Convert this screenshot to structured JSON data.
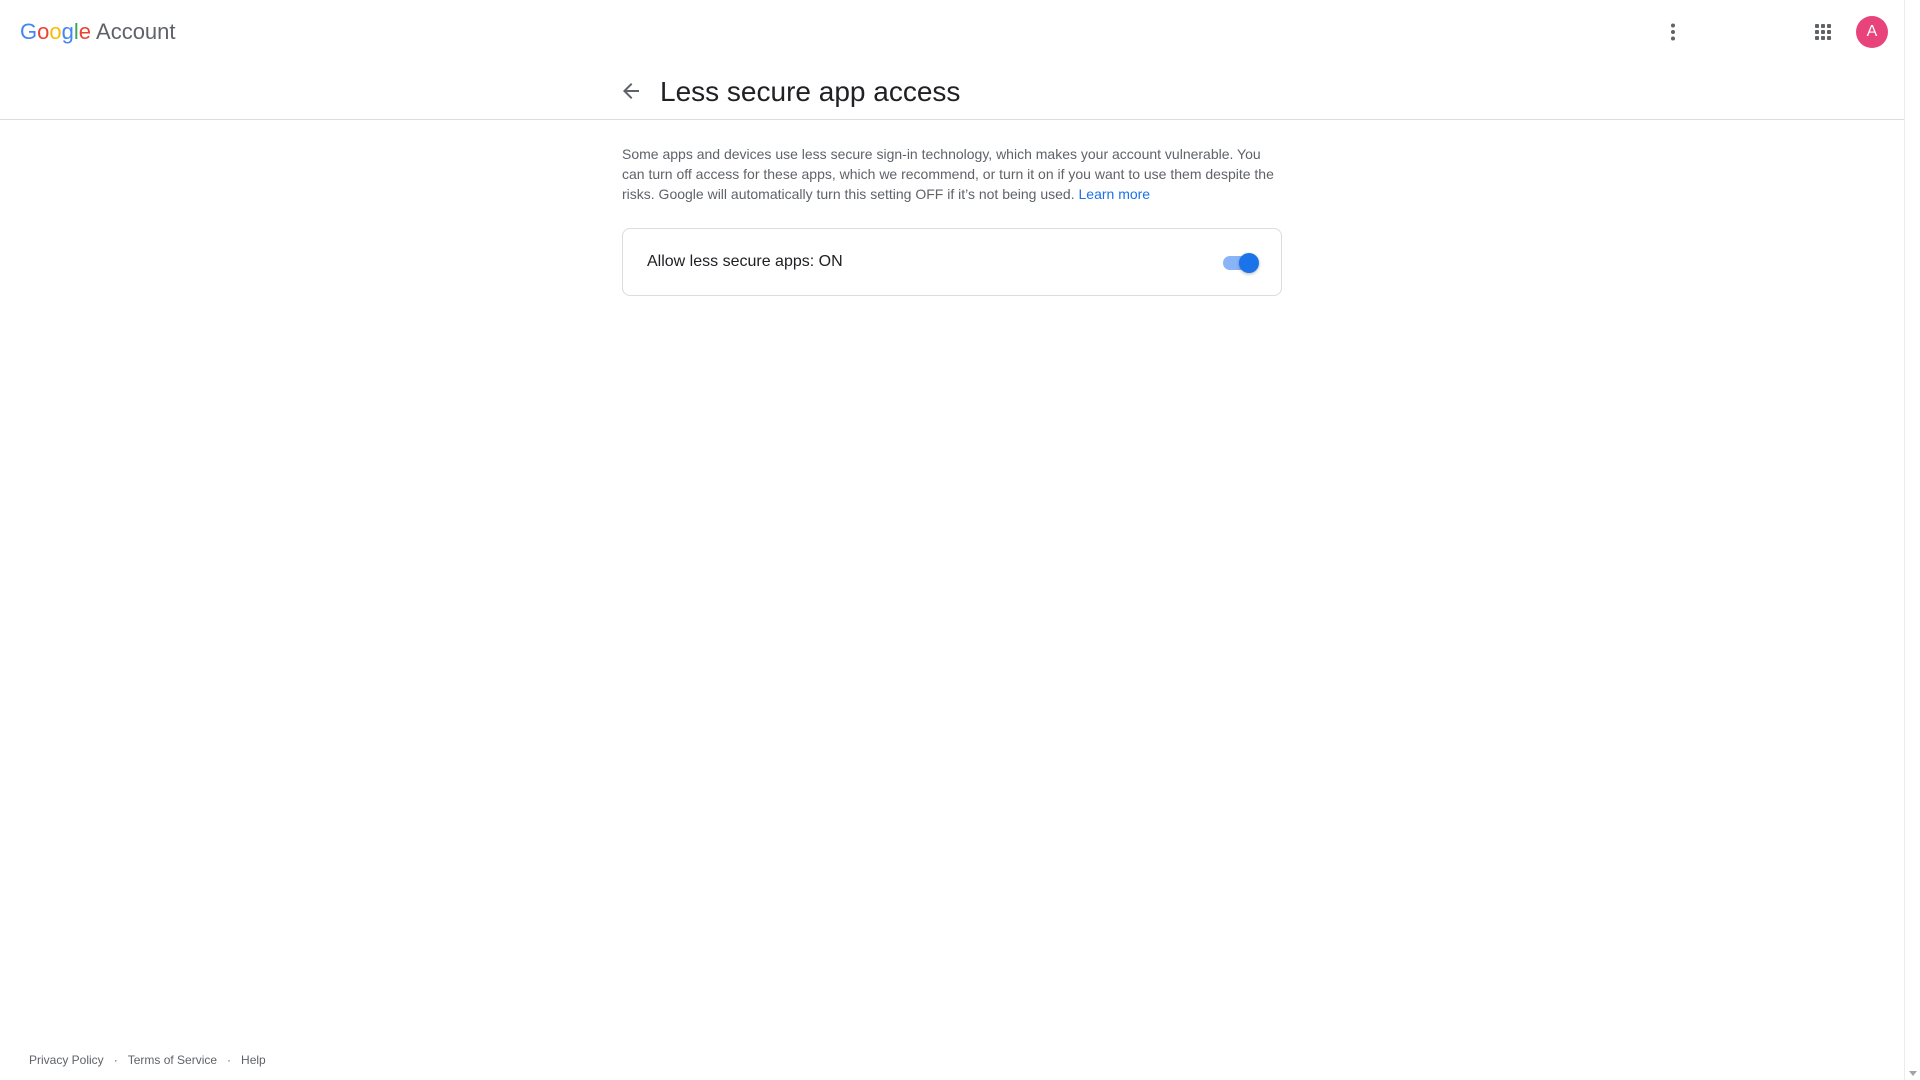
{
  "header": {
    "brand": {
      "google_letters": [
        "G",
        "o",
        "o",
        "g",
        "l",
        "e"
      ],
      "product": "Account"
    },
    "more_options_icon": "vertical-dots-icon",
    "apps_icon": "grid-icon",
    "avatar_initial": "A",
    "avatar_color": "#e8437a"
  },
  "titlebar": {
    "back_icon": "arrow-back-icon",
    "title": "Less secure app access"
  },
  "main": {
    "description": "Some apps and devices use less secure sign-in technology, which makes your account vulnerable. You can turn off access for these apps, which we recommend, or turn it on if you want to use them despite the risks. Google will automatically turn this setting OFF if it’s not being used.",
    "learn_more": "Learn more",
    "setting": {
      "label": "Allow less secure apps: ON",
      "enabled": true,
      "accent_color": "#1a73e8"
    }
  },
  "footer": {
    "links": [
      "Privacy Policy",
      "Terms of Service",
      "Help"
    ],
    "separator": "·"
  }
}
